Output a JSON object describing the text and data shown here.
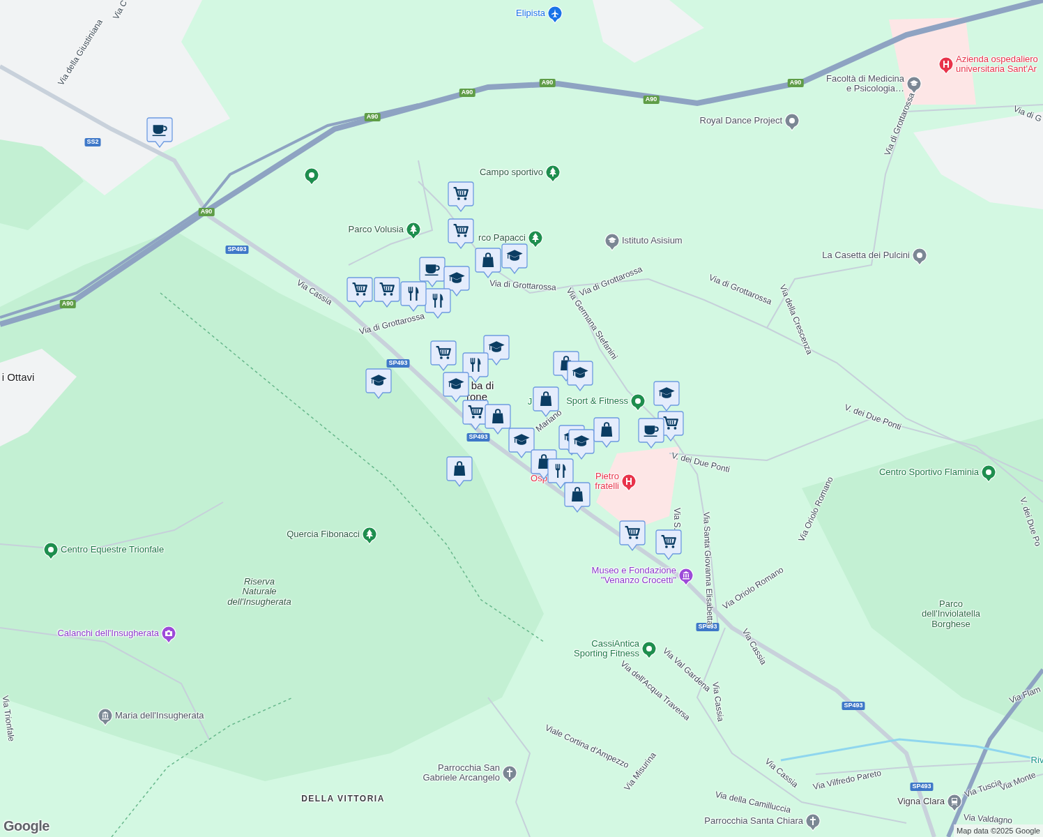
{
  "places": [
    {
      "kind": "airport",
      "lines": [
        "Elipista"
      ]
    },
    {
      "kind": "park",
      "lines": [
        "Campo sportivo"
      ]
    },
    {
      "kind": "green_pin"
    },
    {
      "kind": "park",
      "lines": [
        "Parco Volusia"
      ]
    },
    {
      "kind": "park",
      "lines": [
        "rco Papacci"
      ]
    },
    {
      "kind": "school",
      "lines": [
        "Istituto Asisium"
      ]
    },
    {
      "kind": "grey_pin",
      "lines": [
        "Royal Dance Project"
      ]
    },
    {
      "kind": "school",
      "lines": [
        "Facoltà di Medicina",
        "e Psicologia…"
      ]
    },
    {
      "kind": "hospital",
      "lines": [
        "Azienda ospedaliero",
        "universitaria Sant'Ar"
      ]
    },
    {
      "kind": "grey_pin",
      "lines": [
        "La Casetta dei Pulcini"
      ]
    },
    {
      "kind": "green_pin",
      "lines": [
        "Sport & Fitness"
      ]
    },
    {
      "kind": "hospital",
      "lines": [
        "Pietro",
        "fratelli"
      ]
    },
    {
      "kind": "green_pin",
      "lines": [
        "Centro Sportivo Flaminia"
      ]
    },
    {
      "kind": "park",
      "lines": [
        "Quercia Fibonacci"
      ]
    },
    {
      "kind": "green_pin",
      "lines": [
        "Centro Equestre Trionfale"
      ]
    },
    {
      "kind": "camera",
      "lines": [
        "Calanchi dell'Insugherata"
      ]
    },
    {
      "kind": "museum",
      "lines": [
        "Museo e Fondazione",
        "\"Venanzo Crocetti\""
      ]
    },
    {
      "kind": "green_pin",
      "lines": [
        "CassiAntica",
        "Sporting Fitness"
      ]
    },
    {
      "kind": "museum_grey",
      "lines": [
        "Maria dell'Insugherata"
      ]
    },
    {
      "kind": "church",
      "lines": [
        "Parrocchia San",
        "Gabriele Arcangelo"
      ]
    },
    {
      "kind": "church",
      "lines": [
        "Parrocchia Santa Chiara"
      ]
    },
    {
      "kind": "train",
      "lines": [
        "Vigna Clara"
      ]
    }
  ],
  "area_labels": [
    {
      "kind": "town",
      "lines": [
        "i Ottavi"
      ]
    },
    {
      "kind": "town",
      "lines": [
        "ba di"
      ]
    },
    {
      "kind": "town",
      "lines": [
        "rone"
      ]
    },
    {
      "kind": "green",
      "lines": [
        "J"
      ]
    },
    {
      "kind": "red",
      "lines": [
        "Osp"
      ]
    },
    {
      "kind": "reserve",
      "lines": [
        "Riserva",
        "Naturale",
        "dell'Insugherata"
      ]
    },
    {
      "kind": "park",
      "lines": [
        "Parco",
        "dell'Inviolatella",
        "Borghese"
      ]
    },
    {
      "kind": "district",
      "lines": [
        "DELLA VITTORIA"
      ]
    },
    {
      "kind": "water",
      "lines": [
        "Riv"
      ]
    }
  ],
  "streets": [
    "Via della Giustiniana",
    "Via C",
    "Via Cassia",
    "Via di Grottarossa",
    "Via di Grottarossa",
    "Via di Grottarossa",
    "Via di Grottarossa",
    "Via di Grottarossa",
    "Via di G",
    "Via della Crescenza",
    "Via Germana Stefanini",
    "Mariano",
    "V. dei Due Ponti",
    "V. dei Due Ponti",
    "V. dei Due Po",
    "Via Oriolo Romano",
    "Via Oriolo Romano",
    "Via S.",
    "Via Santa Giovanna Elisabetta",
    "Via Cassia",
    "Via Val Gardena",
    "Via Cassia",
    "Via dell'Acqua Traversa",
    "Viale Cortina d'Ampezzo",
    "Via Misurina",
    "Via Cassia",
    "Via Vilfredo Pareto",
    "Via della Camilluccia",
    "Via Tuscia",
    "Via Monte",
    "Via Valdagno",
    "Via Flam",
    "Via Trionfale"
  ],
  "road_shields": [
    {
      "kind": "motorway",
      "text": "A90"
    },
    {
      "kind": "motorway",
      "text": "A90"
    },
    {
      "kind": "motorway",
      "text": "A90"
    },
    {
      "kind": "motorway",
      "text": "A90"
    },
    {
      "kind": "motorway",
      "text": "A90"
    },
    {
      "kind": "motorway",
      "text": "A90"
    },
    {
      "kind": "motorway",
      "text": "A90"
    },
    {
      "kind": "road",
      "text": "SS2"
    },
    {
      "kind": "road",
      "text": "SP493"
    },
    {
      "kind": "road",
      "text": "SP493"
    },
    {
      "kind": "road",
      "text": "SP493"
    },
    {
      "kind": "road",
      "text": "SP493"
    },
    {
      "kind": "road",
      "text": "SP493"
    },
    {
      "kind": "road",
      "text": "SP493"
    }
  ],
  "markers": [
    {
      "kind": "cafe"
    },
    {
      "kind": "cart"
    },
    {
      "kind": "cart"
    },
    {
      "kind": "school"
    },
    {
      "kind": "shop"
    },
    {
      "kind": "cafe"
    },
    {
      "kind": "school"
    },
    {
      "kind": "food"
    },
    {
      "kind": "cart"
    },
    {
      "kind": "cart"
    },
    {
      "kind": "food"
    },
    {
      "kind": "cart"
    },
    {
      "kind": "school"
    },
    {
      "kind": "food"
    },
    {
      "kind": "school"
    },
    {
      "kind": "school"
    },
    {
      "kind": "shop"
    },
    {
      "kind": "school"
    },
    {
      "kind": "shop"
    },
    {
      "kind": "school"
    },
    {
      "kind": "cart"
    },
    {
      "kind": "cafe"
    },
    {
      "kind": "cart"
    },
    {
      "kind": "shop"
    },
    {
      "kind": "school"
    },
    {
      "kind": "shop"
    },
    {
      "kind": "school"
    },
    {
      "kind": "school"
    },
    {
      "kind": "shop"
    },
    {
      "kind": "shop"
    },
    {
      "kind": "food"
    },
    {
      "kind": "shop"
    },
    {
      "kind": "cart"
    },
    {
      "kind": "cart"
    }
  ],
  "logo": "Google",
  "attribution": "Map data ©2025 Google"
}
